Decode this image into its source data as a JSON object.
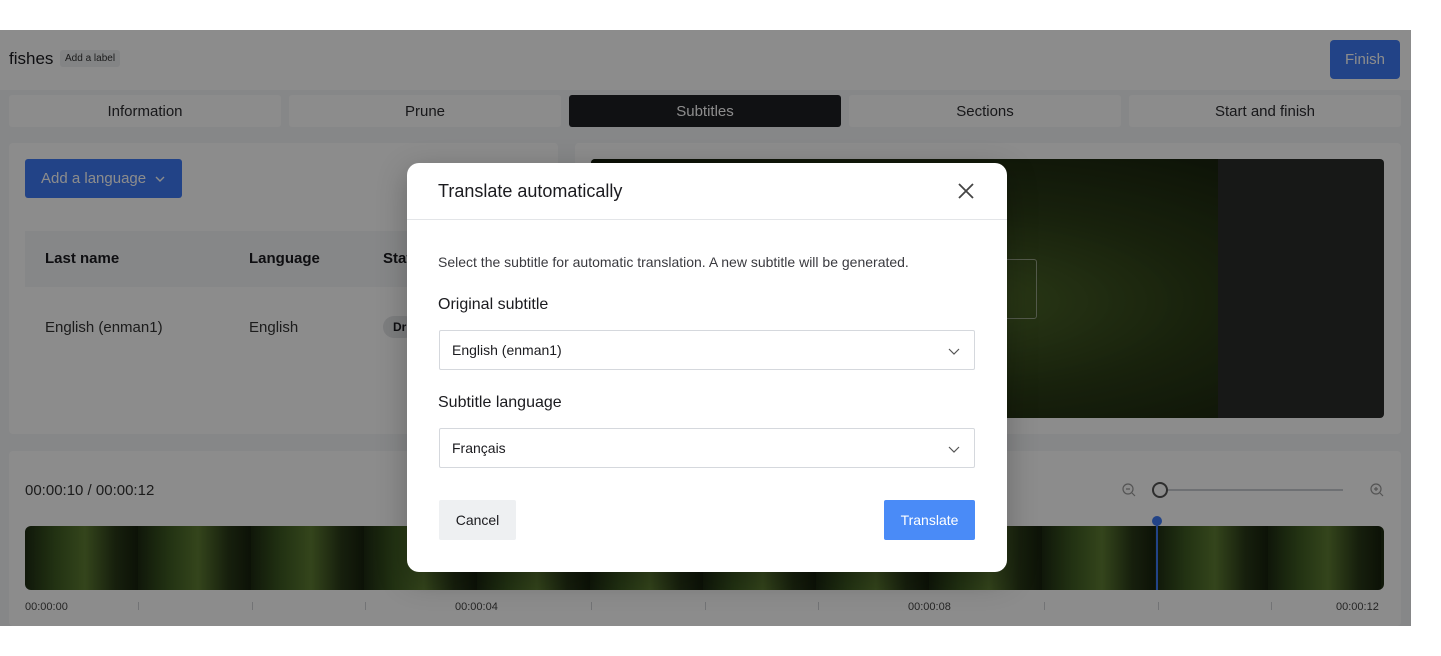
{
  "header": {
    "title": "fishes",
    "label_chip": "Add a label",
    "finish_label": "Finish"
  },
  "tabs": [
    {
      "label": "Information",
      "active": false
    },
    {
      "label": "Prune",
      "active": false
    },
    {
      "label": "Subtitles",
      "active": true
    },
    {
      "label": "Sections",
      "active": false
    },
    {
      "label": "Start and finish",
      "active": false
    }
  ],
  "subtitles_panel": {
    "add_language_label": "Add a language",
    "columns": [
      "Last name",
      "Language",
      "Stat"
    ],
    "rows": [
      {
        "name": "English (enman1)",
        "language": "English",
        "status": "Dr"
      }
    ]
  },
  "timeline": {
    "time": "00:00:10 / 00:00:12",
    "tick_labels": [
      "00:00:00",
      "00:00:04",
      "00:00:08",
      "00:00:12"
    ],
    "playhead_fraction": 0.833,
    "zoom_fraction": 0.0
  },
  "modal": {
    "title": "Translate automatically",
    "description": "Select the subtitle for automatic translation. A new subtitle will be generated.",
    "original_label": "Original subtitle",
    "original_value": "English (enman1)",
    "language_label": "Subtitle language",
    "language_value": "Français",
    "cancel_label": "Cancel",
    "translate_label": "Translate"
  },
  "colors": {
    "accent": "#3e7bf6",
    "translate": "#4a8bf7",
    "active_tab": "#1e1f24"
  },
  "icons": [
    "chevron-down-icon",
    "close-icon",
    "zoom-out-icon",
    "zoom-in-icon"
  ]
}
